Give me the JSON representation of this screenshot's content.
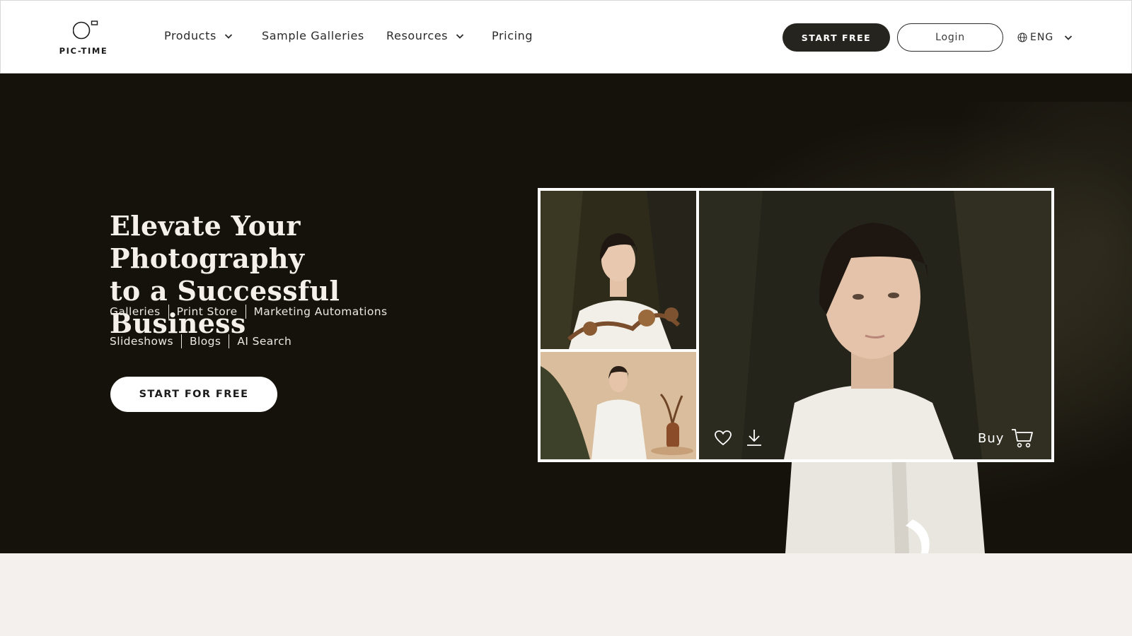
{
  "brand": {
    "logo_text": "PIC-TIME",
    "logo_icon": "camera-lens-logo"
  },
  "nav": {
    "items": [
      {
        "label": "Products",
        "has_dropdown": true
      },
      {
        "label": "Sample Galleries",
        "has_dropdown": false
      },
      {
        "label": "Resources",
        "has_dropdown": true
      },
      {
        "label": "Pricing",
        "has_dropdown": false
      }
    ]
  },
  "header_actions": {
    "start_free_label": "START FREE",
    "login_label": "Login",
    "language_label": "ENG",
    "language_icon": "globe-icon"
  },
  "hero": {
    "title_line1": "Elevate Your Photography",
    "title_line2": "to a Successful Business",
    "features_row1": [
      "Galleries",
      "Print Store",
      "Marketing Automations"
    ],
    "features_row2": [
      "Slideshows",
      "Blogs",
      "AI Search"
    ],
    "cta_label": "START FOR FREE"
  },
  "gallery": {
    "buy_label": "Buy",
    "icons": [
      "heart-icon",
      "download-icon",
      "cart-icon"
    ]
  },
  "colors": {
    "hero_bg": "#15120c",
    "header_bg": "#ffffff",
    "dark_button": "#25241f",
    "bottom_band": "#f3f0ee"
  }
}
